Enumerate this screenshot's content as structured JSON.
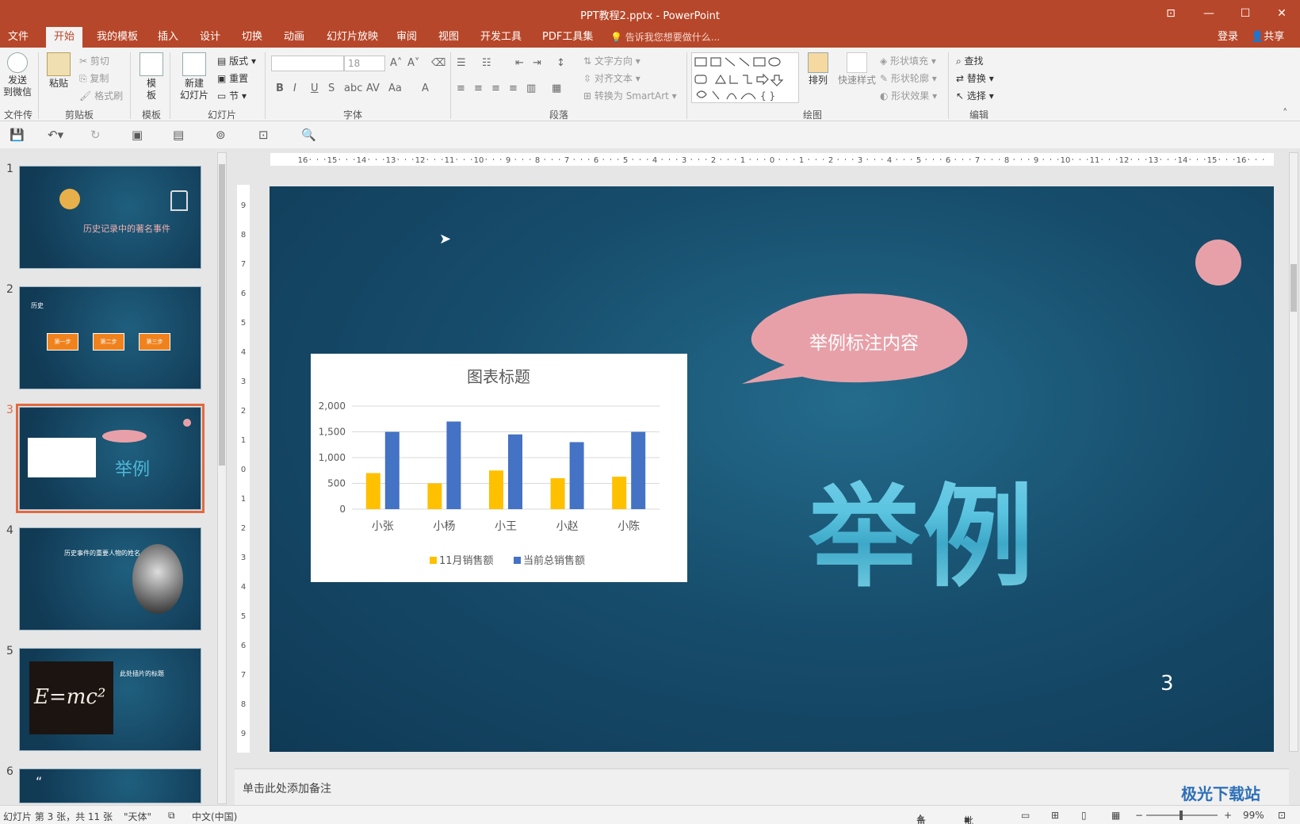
{
  "window": {
    "title": "PPT教程2.pptx - PowerPoint"
  },
  "menu": {
    "tabs": [
      "文件",
      "开始",
      "我的模板",
      "插入",
      "设计",
      "切换",
      "动画",
      "幻灯片放映",
      "审阅",
      "视图",
      "开发工具",
      "PDF工具集"
    ],
    "active": "开始",
    "tell_me": "告诉我您想要做什么...",
    "login": "登录",
    "share": "共享"
  },
  "ribbon": {
    "groups": [
      "文件传输",
      "剪贴板",
      "模板",
      "幻灯片",
      "字体",
      "段落",
      "绘图",
      "编辑"
    ],
    "send_wechat": [
      "发送",
      "到微信"
    ],
    "paste": "粘贴",
    "cut": "剪切",
    "copy": "复制",
    "format_painter": "格式刷",
    "template": [
      "模",
      "板"
    ],
    "new_slide": [
      "新建",
      "幻灯片"
    ],
    "layout": "版式",
    "reset": "重置",
    "section": "节",
    "font_size": "18",
    "text_direction": "文字方向",
    "align_text": "对齐文本",
    "convert_smartart": "转换为 SmartArt",
    "arrange": "排列",
    "quick_styles": "快速样式",
    "shape_fill": "形状填充",
    "shape_outline": "形状轮廓",
    "shape_effects": "形状效果",
    "find": "查找",
    "replace": "替换",
    "select": "选择"
  },
  "thumbnails": {
    "numbers": [
      "1",
      "2",
      "3",
      "4",
      "5",
      "6"
    ],
    "selected": 3,
    "t1_title": "历史记录中的著名事件",
    "t2_label": "历史",
    "t2_steps": [
      "第一步",
      "第二步",
      "第三步"
    ],
    "t3_text": "举例",
    "t4_title": "历史事件的重要人物的姓名",
    "t5_formula": "E=mc²",
    "t5_title": "此处插片的标题"
  },
  "slide": {
    "callout": "举例标注内容",
    "big_text": "举例",
    "page_number": "3"
  },
  "chart_data": {
    "type": "bar",
    "title": "图表标题",
    "categories": [
      "小张",
      "小杨",
      "小王",
      "小赵",
      "小陈"
    ],
    "series": [
      {
        "name": "11月销售额",
        "values": [
          700,
          500,
          750,
          600,
          630
        ],
        "color": "#ffc000"
      },
      {
        "name": "当前总销售额",
        "values": [
          1500,
          1700,
          1450,
          1300,
          1500
        ],
        "color": "#4472c4"
      }
    ],
    "ylim": [
      0,
      2000
    ],
    "yticks": [
      "0",
      "500",
      "1,000",
      "1,500",
      "2,000"
    ],
    "grid": true,
    "legend": "bottom"
  },
  "notes": {
    "placeholder": "单击此处添加备注"
  },
  "status": {
    "slide_info": "幻灯片 第 3 张，共 11 张",
    "theme": "\"天体\"",
    "language": "中文(中国)",
    "notes": "备注",
    "comments": "批注",
    "zoom": "99%"
  },
  "watermark": "极光下载站",
  "colors": {
    "accent": "#b7472a",
    "callout": "#e8a0a8",
    "selection": "#e2693f"
  }
}
